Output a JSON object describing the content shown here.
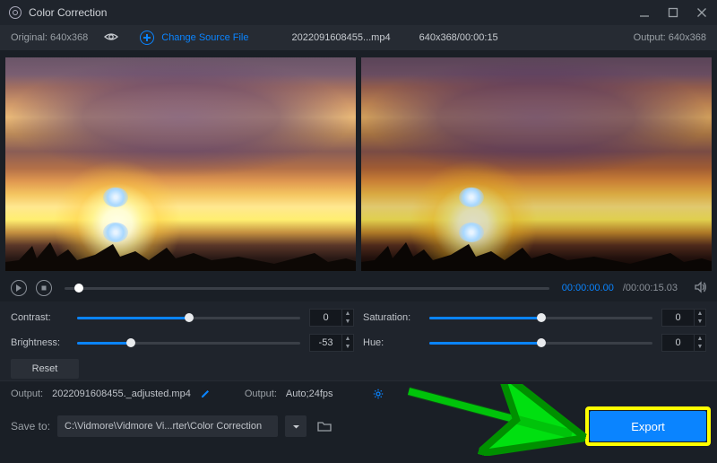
{
  "title": "Color Correction",
  "sourcebar": {
    "original_label": "Original:",
    "original_dims": "640x368",
    "change_source": "Change Source File",
    "filename": "2022091608455...mp4",
    "fileinfo": "640x368/00:00:15",
    "output_label": "Output:",
    "output_dims": "640x368"
  },
  "playback": {
    "current": "00:00:00.00",
    "total": "/00:00:15.03"
  },
  "sliders": {
    "contrast": {
      "label": "Contrast:",
      "value": "0",
      "pct": 50
    },
    "saturation": {
      "label": "Saturation:",
      "value": "0",
      "pct": 50
    },
    "brightness": {
      "label": "Brightness:",
      "value": "-53",
      "pct": 24
    },
    "hue": {
      "label": "Hue:",
      "value": "0",
      "pct": 50
    }
  },
  "reset_label": "Reset",
  "output_row": {
    "out_label": "Output:",
    "out_filename": "2022091608455._adjusted.mp4",
    "fmt_label": "Output:",
    "fmt_value": "Auto;24fps"
  },
  "bottom": {
    "saveto_label": "Save to:",
    "path": "C:\\Vidmore\\Vidmore Vi...rter\\Color Correction",
    "export_label": "Export"
  }
}
